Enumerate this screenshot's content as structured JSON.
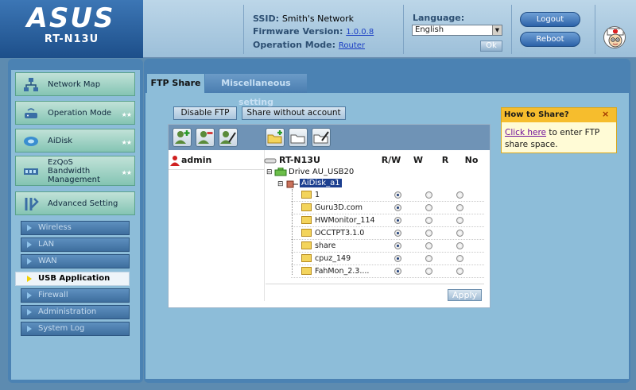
{
  "header": {
    "brand": "ASUS",
    "model": "RT-N13U",
    "ssid_label": "SSID:",
    "ssid_value": "Smith's Network",
    "firmware_label": "Firmware Version:",
    "firmware_value": "1.0.0.8",
    "mode_label": "Operation Mode:",
    "mode_value": "Router",
    "language_label": "Language:",
    "language_selected": "English",
    "ok_label": "Ok",
    "logout_label": "Logout",
    "reboot_label": "Reboot"
  },
  "sidebar": {
    "items": [
      {
        "label": "Network Map",
        "icon": "network-map-icon"
      },
      {
        "label": "Operation Mode",
        "icon": "operation-mode-icon"
      },
      {
        "label": "AiDisk",
        "icon": "aidisk-icon"
      },
      {
        "label": "EzQoS Bandwidth Management",
        "icon": "qos-icon"
      },
      {
        "label": "Advanced Setting",
        "icon": "tools-icon"
      }
    ],
    "sub_items": [
      {
        "label": "Wireless",
        "active": false
      },
      {
        "label": "LAN",
        "active": false
      },
      {
        "label": "WAN",
        "active": false
      },
      {
        "label": "USB Application",
        "active": true
      },
      {
        "label": "Firewall",
        "active": false
      },
      {
        "label": "Administration",
        "active": false
      },
      {
        "label": "System Log",
        "active": false
      }
    ]
  },
  "tabs": [
    {
      "label": "FTP Share",
      "active": true
    },
    {
      "label": "Miscellaneous setting",
      "active": false
    }
  ],
  "actions": {
    "disable_ftp": "Disable FTP",
    "share_without_account": "Share without account"
  },
  "ftp": {
    "user": "admin",
    "router": "RT-N13U",
    "drive": "Drive AU_USB20",
    "disk": "AiDisk_a1",
    "columns": [
      "R/W",
      "W",
      "R",
      "No"
    ],
    "folders": [
      {
        "name": "1",
        "perm": "R/W"
      },
      {
        "name": "Guru3D.com",
        "perm": "R/W"
      },
      {
        "name": "HWMonitor_114",
        "perm": "R/W"
      },
      {
        "name": "OCCTPT3.1.0",
        "perm": "R/W"
      },
      {
        "name": "share",
        "perm": "R/W"
      },
      {
        "name": "cpuz_149",
        "perm": "R/W"
      },
      {
        "name": "FahMon_2.3....",
        "perm": "R/W"
      }
    ],
    "apply_label": "Apply"
  },
  "help": {
    "title": "How to Share?",
    "close": "×",
    "link_text": "Click here",
    "body_text": " to enter FTP share space."
  },
  "colors": {
    "brand_blue": "#1d4f8a",
    "panel_blue": "#4b82b3",
    "panel_light": "#8dbdd9",
    "help_yellow": "#f6bd2d"
  }
}
